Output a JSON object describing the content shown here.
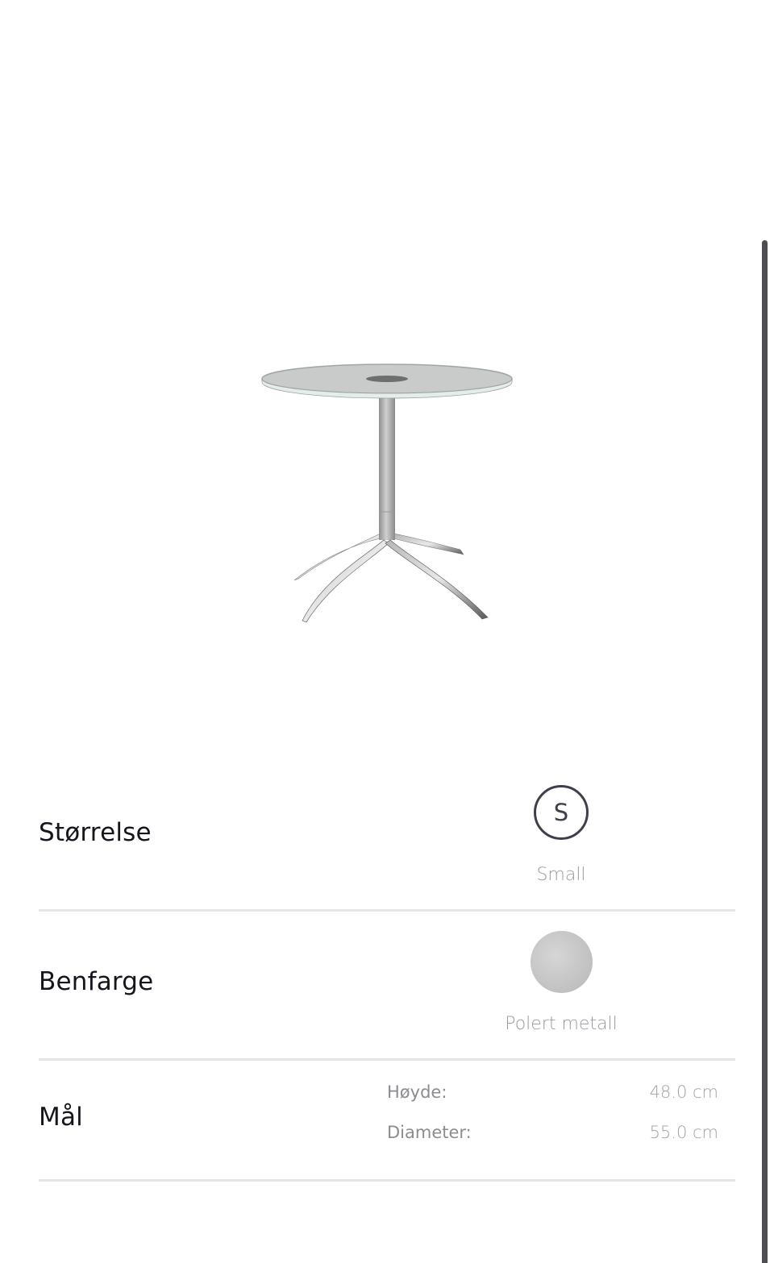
{
  "attributes": {
    "size": {
      "label": "Størrelse",
      "selected_letter": "S",
      "selected_name": "Small"
    },
    "leg_color": {
      "label": "Benfarge",
      "selected_name": "Polert metall",
      "swatch_color": "#c7c6c6"
    },
    "dimensions": {
      "label": "Mål",
      "items": [
        {
          "name": "Høyde:",
          "value": "48.0 cm"
        },
        {
          "name": "Diameter:",
          "value": "55.0 cm"
        }
      ]
    }
  },
  "colors": {
    "text": "#15151d",
    "muted": "#9a9aa0",
    "divider": "#e6e6e2",
    "scrollbar": "#4d4d52"
  }
}
